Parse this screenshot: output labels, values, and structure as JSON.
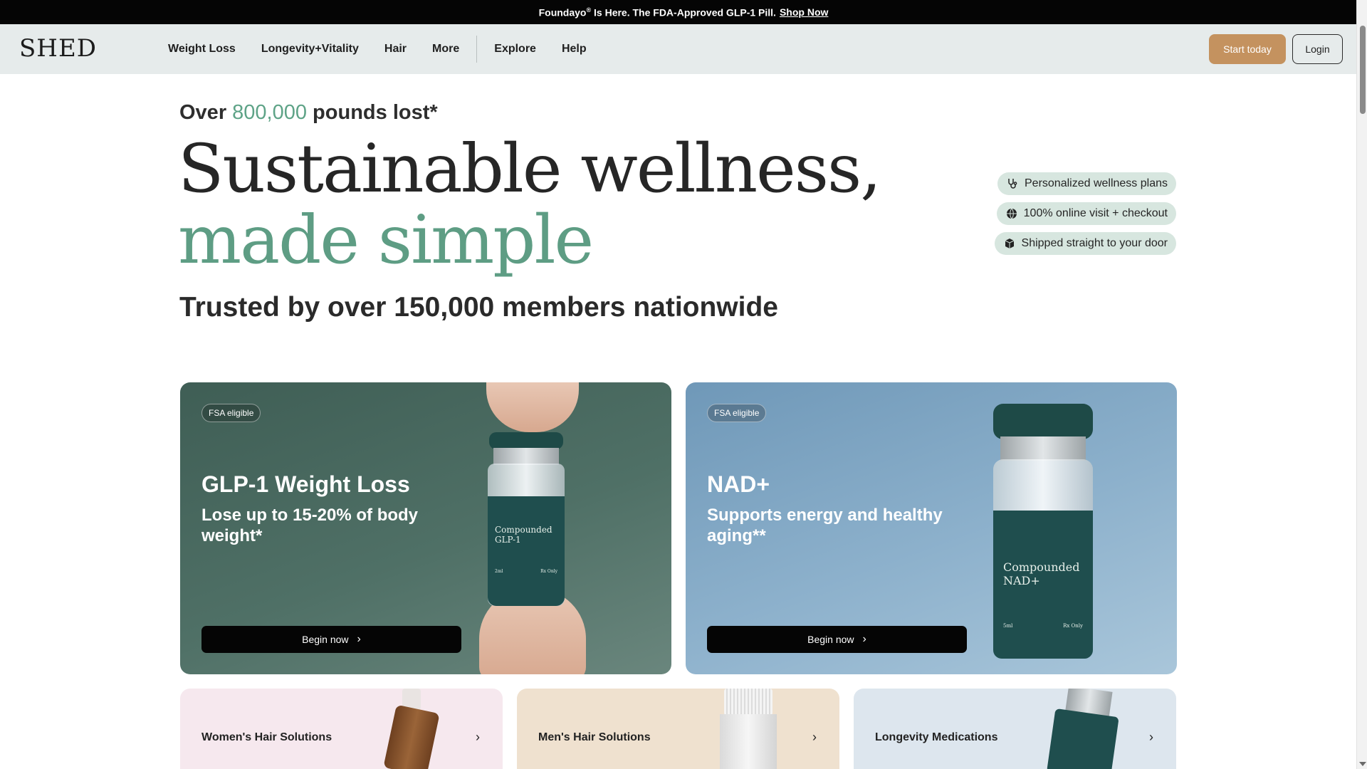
{
  "announcement": {
    "text_pre": "Foundayo",
    "reg": "®",
    "text_post": " Is Here. The FDA-Approved GLP-1 Pill.",
    "link": "Shop Now"
  },
  "nav": {
    "logo": "SHED",
    "links": [
      "Weight Loss",
      "Longevity+Vitality",
      "Hair",
      "More"
    ],
    "links2": [
      "Explore",
      "Help"
    ],
    "start_label": "Start today",
    "login_label": "Login"
  },
  "hero": {
    "stat_pre": "Over ",
    "stat_num": "800,000",
    "stat_post": " pounds lost*",
    "headline_1": "Sustainable wellness,",
    "headline_2": "made simple",
    "trusted": "Trusted by over 150,000 members nationwide",
    "pills": [
      {
        "icon": "stethoscope-icon",
        "label": "Personalized wellness plans"
      },
      {
        "icon": "globe-icon",
        "label": "100% online visit + checkout"
      },
      {
        "icon": "box-icon",
        "label": "Shipped straight to your door"
      }
    ]
  },
  "cards": [
    {
      "badge": "FSA eligible",
      "title": "GLP-1 Weight Loss",
      "subtitle": "Lose up to 15-20% of body weight*",
      "button": "Begin now",
      "vial_label_1": "Compounded",
      "vial_label_2": "GLP-1",
      "vial_small_1": "2ml",
      "vial_small_2": "Rx Only",
      "color": "#4a6b62"
    },
    {
      "badge": "FSA eligible",
      "title": "NAD+",
      "subtitle": "Supports energy and healthy aging**",
      "button": "Begin now",
      "vial_label_1": "Compounded",
      "vial_label_2": "NAD+",
      "vial_small_1": "5ml",
      "vial_small_2": "Rx Only",
      "color": "#8aaecb"
    }
  ],
  "mini_cards": [
    {
      "label": "Women's Hair Solutions"
    },
    {
      "label": "Men's Hair Solutions"
    },
    {
      "label": "Longevity Medications"
    }
  ],
  "colors": {
    "accent_green": "#5ea387",
    "cta_tan": "#c4925f",
    "nav_bg": "#e6ebeb",
    "pill_bg": "#d7e6df"
  }
}
